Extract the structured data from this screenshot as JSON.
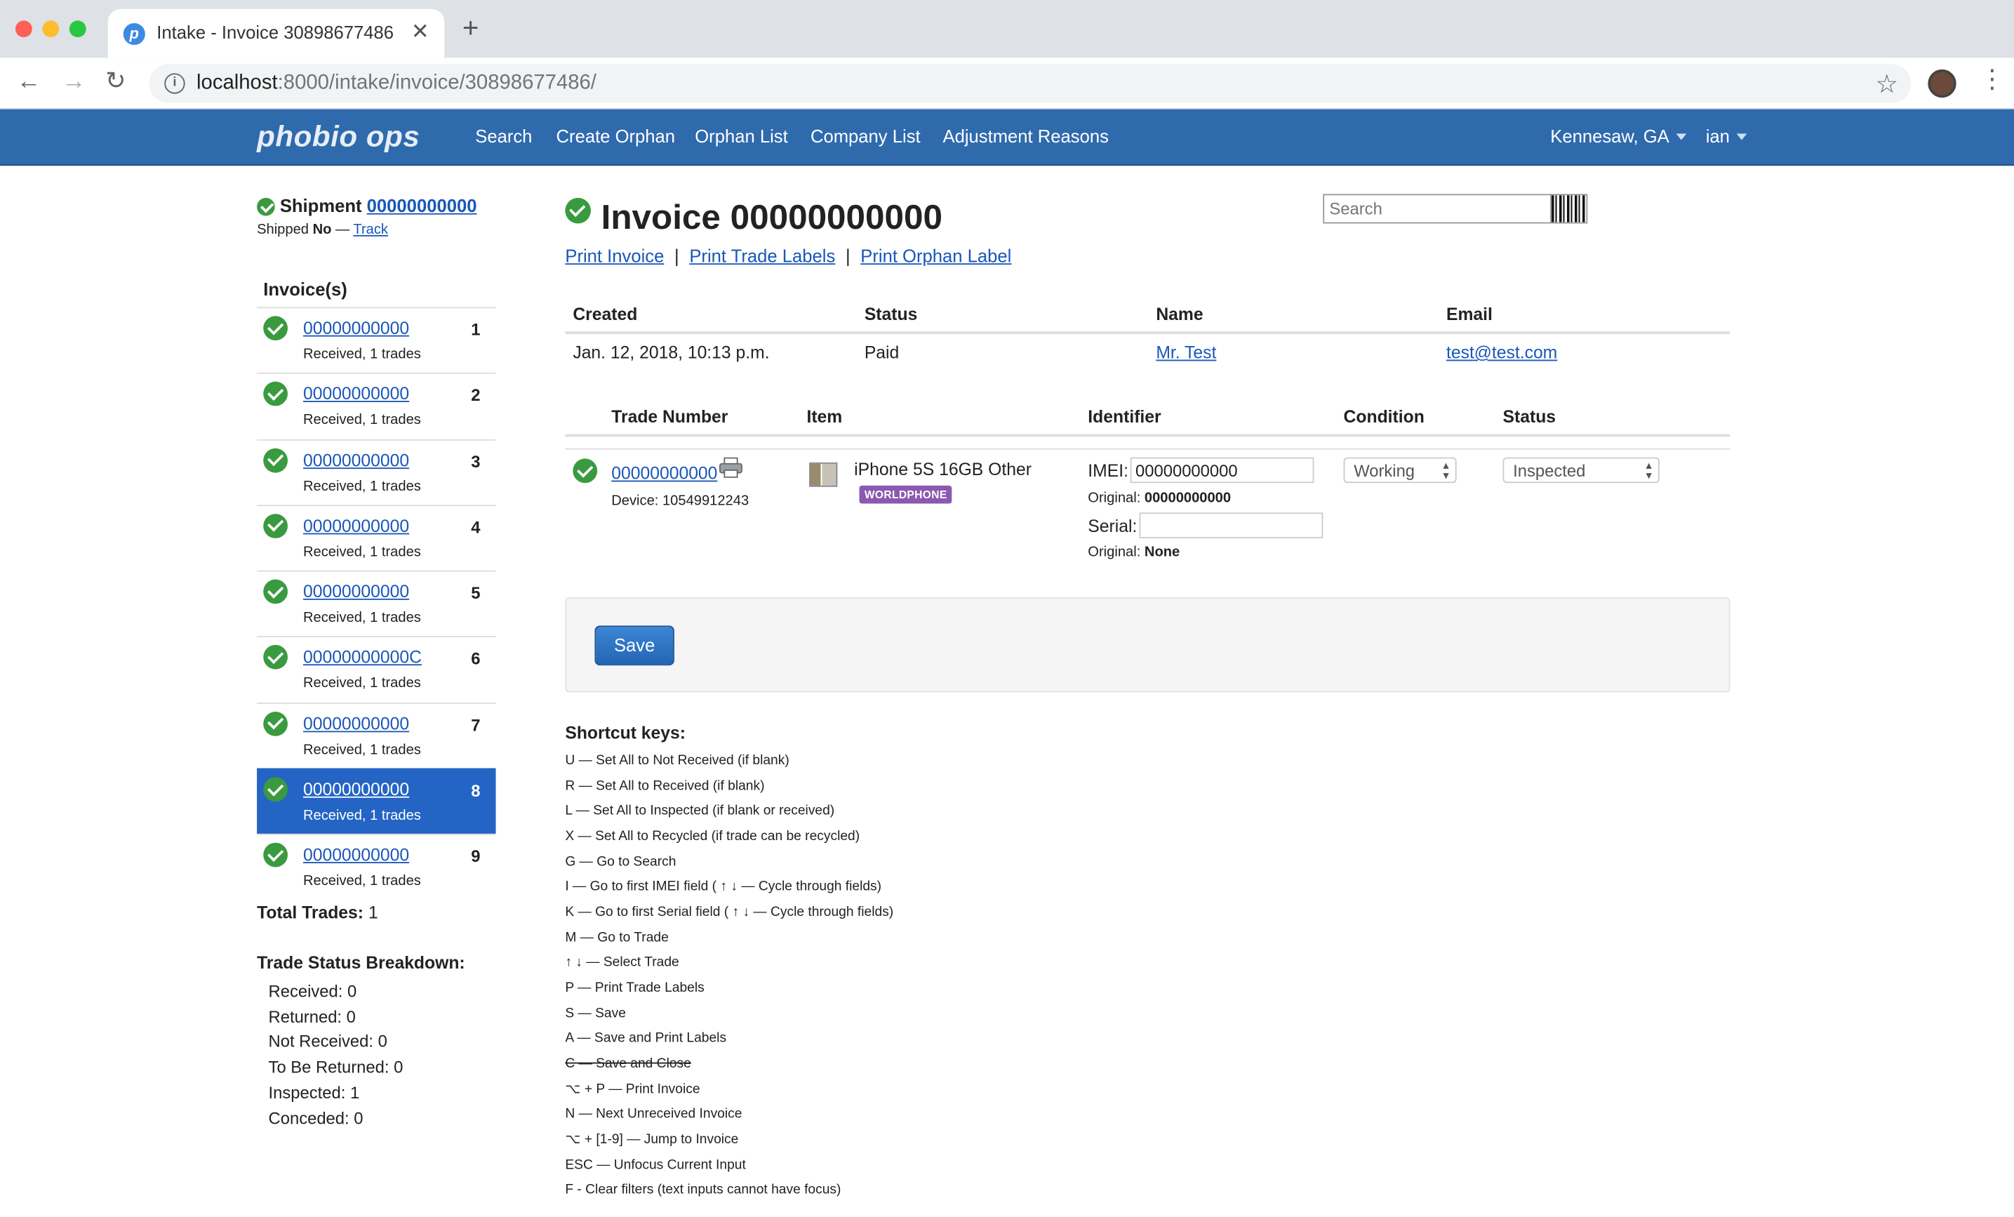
{
  "browser": {
    "tab_title": "Intake - Invoice 30898677486",
    "url_host": "localhost",
    "url_rest": ":8000/intake/invoice/30898677486/",
    "favicon_letter": "p",
    "close_glyph": "✕",
    "new_tab_glyph": "+",
    "back_glyph": "←",
    "forward_glyph": "→",
    "reload_glyph": "↻",
    "info_glyph": "i",
    "star_glyph": "☆",
    "menu_glyph": "⋮"
  },
  "navbar": {
    "brand": "phobio ops",
    "links": [
      "Search",
      "Create Orphan",
      "Orphan List",
      "Company List",
      "Adjustment Reasons"
    ],
    "location": "Kennesaw, GA",
    "user": "ian"
  },
  "shipment": {
    "label": "Shipment",
    "number": "00000000000",
    "shipped_label": "Shipped",
    "shipped_value": "No",
    "dash": "—",
    "track_label": "Track"
  },
  "sidebar": {
    "heading": "Invoice(s)",
    "invoices": [
      {
        "number": "00000000000",
        "sub": "Received, 1 trades",
        "index": "1"
      },
      {
        "number": "00000000000",
        "sub": "Received, 1 trades",
        "index": "2"
      },
      {
        "number": "00000000000",
        "sub": "Received, 1 trades",
        "index": "3"
      },
      {
        "number": "00000000000",
        "sub": "Received, 1 trades",
        "index": "4"
      },
      {
        "number": "00000000000",
        "sub": "Received, 1 trades",
        "index": "5"
      },
      {
        "number": "00000000000C",
        "sub": "Received, 1 trades",
        "index": "6"
      },
      {
        "number": "00000000000",
        "sub": "Received, 1 trades",
        "index": "7"
      },
      {
        "number": "00000000000",
        "sub": "Received, 1 trades",
        "index": "8"
      },
      {
        "number": "00000000000",
        "sub": "Received, 1 trades",
        "index": "9"
      }
    ],
    "active_index": 8,
    "total_trades_label": "Total Trades:",
    "total_trades_value": "1",
    "breakdown_title": "Trade Status Breakdown:",
    "breakdown": [
      "Received: 0",
      "Returned: 0",
      "Not Received: 0",
      "To Be Returned: 0",
      "Inspected: 1",
      "Conceded: 0"
    ]
  },
  "invoice": {
    "title": "Invoice 00000000000",
    "search_placeholder": "Search",
    "print_links": [
      "Print Invoice",
      "Print Trade Labels",
      "Print Orphan Label"
    ],
    "link_sep": "|",
    "summary_headers": [
      "Created",
      "Status",
      "Name",
      "Email"
    ],
    "created": "Jan. 12, 2018, 10:13 p.m.",
    "status": "Paid",
    "name": "Mr. Test",
    "email": "test@test.com"
  },
  "trades": {
    "headers": [
      "Trade Number",
      "Item",
      "Identifier",
      "Condition",
      "Status"
    ],
    "row": {
      "number": "00000000000",
      "device": "Device: 10549912243",
      "item": "iPhone 5S 16GB Other",
      "badge": "WORLDPHONE",
      "imei_label": "IMEI:",
      "imei_value": "00000000000",
      "original_label": "Original:",
      "imei_original": "00000000000",
      "serial_label": "Serial:",
      "serial_value": "",
      "serial_original": "None",
      "condition": "Working",
      "status": "Inspected"
    }
  },
  "save_label": "Save",
  "shortcuts": {
    "title": "Shortcut keys:",
    "items": [
      "U — Set All to Not Received (if blank)",
      "R — Set All to Received (if blank)",
      "L — Set All to Inspected (if blank or received)",
      "X — Set All to Recycled (if trade can be recycled)",
      "G — Go to Search",
      "I — Go to first IMEI field ( ↑ ↓ — Cycle through fields)",
      "K — Go to first Serial field ( ↑ ↓ — Cycle through fields)",
      "M — Go to Trade",
      "↑ ↓ — Select Trade",
      "P — Print Trade Labels",
      "S — Save",
      "A — Save and Print Labels",
      "C — Save and Close",
      "⌥ + P — Print Invoice",
      "N — Next Unreceived Invoice",
      "⌥ + [1-9] — Jump to Invoice",
      "ESC — Unfocus Current Input",
      "F - Clear filters (text inputs cannot have focus)"
    ],
    "struck_index": 12
  },
  "colors": {
    "navbar": "#2f6aad",
    "active_invoice": "#2464c4",
    "check_green": "#3a9a3f",
    "badge_purple": "#8b59b0",
    "link": "#1a56b8"
  }
}
